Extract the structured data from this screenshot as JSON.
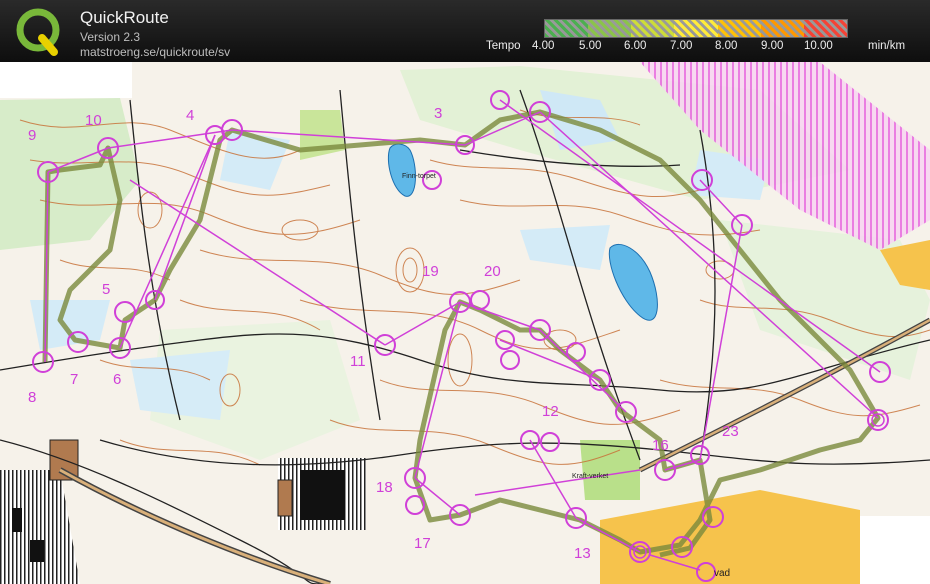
{
  "app": {
    "title": "QuickRoute",
    "version": "Version 2.3",
    "url": "matstroeng.se/quickroute/sv"
  },
  "legend": {
    "label": "Tempo",
    "ticks": [
      "4.00",
      "5.00",
      "6.00",
      "7.00",
      "8.00",
      "9.00",
      "10.00"
    ],
    "unit": "min/km",
    "gradient_colors": [
      "#4caf50",
      "#8bc34a",
      "#cddc39",
      "#ffeb3b",
      "#ffc107",
      "#ff9800",
      "#f44336"
    ]
  },
  "map": {
    "lake_label": "Finn-torpet",
    "place_label": "Kraft-verket",
    "bottom_label": "vad",
    "control_numbers": [
      "9",
      "10",
      "4",
      "3",
      "5",
      "7",
      "6",
      "8",
      "19",
      "20",
      "11",
      "12",
      "16",
      "23",
      "18",
      "17",
      "13"
    ],
    "colors": {
      "route_line": "#7a8a3c",
      "control_marks": "#d040d8",
      "contours": "#c8733a",
      "water": "#8fcff0",
      "forbidden": "#e86adf",
      "urban": "#f5c04a"
    }
  }
}
